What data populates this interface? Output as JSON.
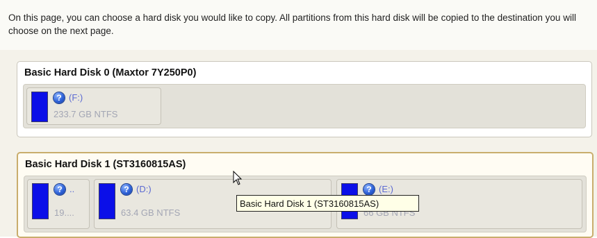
{
  "intro": {
    "text": "On this page, you can choose a hard disk you would like to copy. All partitions from this hard disk will be copied to the destination you will choose on the next page."
  },
  "disks": [
    {
      "title": "Basic Hard Disk 0 (Maxtor 7Y250P0)",
      "selected": false,
      "partitions": [
        {
          "letter": "(F:)",
          "size": "233.7 GB NTFS",
          "icon": "question-icon"
        }
      ]
    },
    {
      "title": "Basic Hard Disk 1 (ST3160815AS)",
      "selected": true,
      "partitions": [
        {
          "letter": "..",
          "size": "19....",
          "icon": "question-icon"
        },
        {
          "letter": "(D:)",
          "size": "63.4 GB NTFS",
          "icon": "question-icon"
        },
        {
          "letter": "(E:)",
          "size": "66 GB NTFS",
          "icon": "question-icon"
        }
      ]
    }
  ],
  "tooltip": {
    "text": "Basic Hard Disk 1 (ST3160815AS)"
  },
  "colors": {
    "partition_bar": "#0b0fe8",
    "selected_border": "#c9ad6c",
    "tooltip_bg": "#ffffe7"
  }
}
